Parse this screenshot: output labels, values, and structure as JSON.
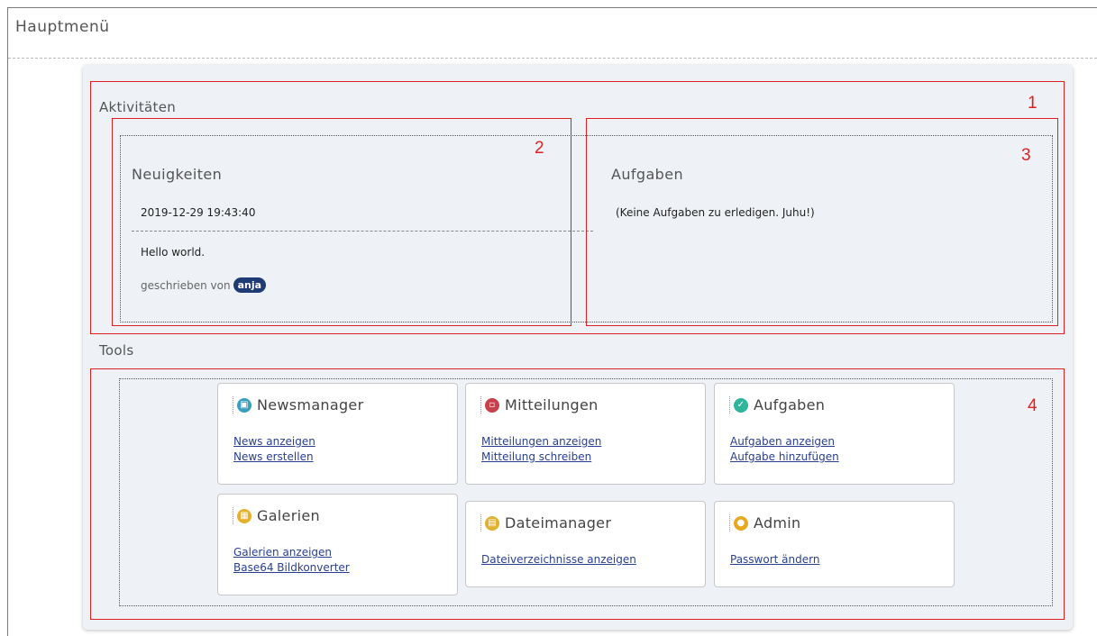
{
  "page": {
    "title": "Hauptmenü"
  },
  "activities": {
    "heading": "Aktivitäten",
    "news": {
      "heading": "Neuigkeiten",
      "timestamp": "2019-12-29 19:43:40",
      "body": "Hello world.",
      "author_prefix": "geschrieben von",
      "author": "anja"
    },
    "tasks": {
      "heading": "Aufgaben",
      "empty_message": "(Keine Aufgaben zu erledigen. Juhu!)"
    }
  },
  "tools": {
    "heading": "Tools",
    "cards": [
      {
        "title": "Newsmanager",
        "icon": "newspaper-icon",
        "color": "#3a9fbf",
        "links": [
          "News anzeigen",
          "News erstellen"
        ]
      },
      {
        "title": "Mitteilungen",
        "icon": "message-icon",
        "color": "#c8404a",
        "links": [
          "Mitteilungen anzeigen",
          "Mitteilung schreiben"
        ]
      },
      {
        "title": "Aufgaben",
        "icon": "check-icon",
        "color": "#2fb59c",
        "links": [
          "Aufgaben anzeigen",
          "Aufgabe hinzufügen"
        ]
      },
      {
        "title": "Galerien",
        "icon": "image-icon",
        "color": "#e8b02a",
        "links": [
          "Galerien anzeigen",
          "Base64 Bildkonverter"
        ]
      },
      {
        "title": "Dateimanager",
        "icon": "file-icon",
        "color": "#e0b030",
        "links": [
          "Dateiverzeichnisse anzeigen"
        ]
      },
      {
        "title": "Admin",
        "icon": "lock-icon",
        "color": "#e8a820",
        "links": [
          "Passwort ändern"
        ]
      }
    ]
  },
  "annotations": [
    "1",
    "2",
    "3",
    "4"
  ],
  "annotation_color": "#e02020"
}
